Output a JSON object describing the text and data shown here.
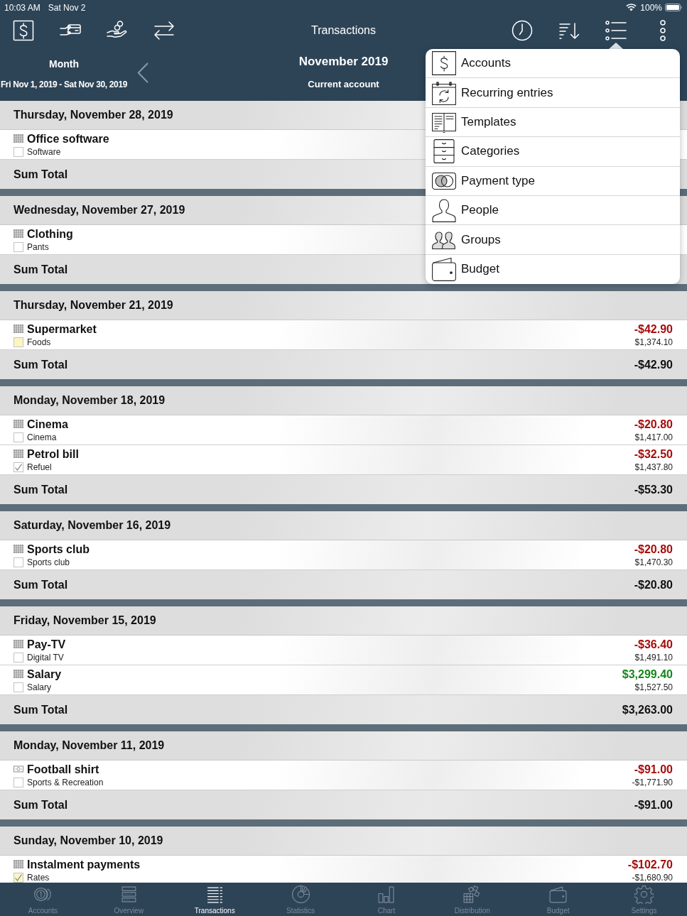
{
  "status_bar": {
    "time": "10:03 AM",
    "date": "Sat Nov 2",
    "battery": "100%"
  },
  "toolbar": {
    "title": "Transactions"
  },
  "period": {
    "mode": "Month",
    "range": "Fri Nov 1, 2019 - Sat Nov 30, 2019",
    "title": "November 2019",
    "account": "Current account"
  },
  "days": [
    {
      "date": "Thursday, November 28, 2019",
      "transactions": [
        {
          "title": "Office software",
          "category": "Software",
          "kind": "grid",
          "checked": false,
          "color": "#ffffff"
        }
      ],
      "sum": {
        "label": "Sum Total"
      }
    },
    {
      "date": "Wednesday, November 27, 2019",
      "transactions": [
        {
          "title": "Clothing",
          "category": "Pants",
          "kind": "grid",
          "checked": false,
          "color": "#ffffff"
        }
      ],
      "sum": {
        "label": "Sum Total"
      }
    },
    {
      "date": "Thursday, November 21, 2019",
      "transactions": [
        {
          "title": "Supermarket",
          "category": "Foods",
          "kind": "grid",
          "checked": false,
          "color": "#fbf5c1",
          "amount": "-$42.90",
          "income": false,
          "balance": "$1,374.10"
        }
      ],
      "sum": {
        "label": "Sum Total",
        "value": "-$42.90"
      }
    },
    {
      "date": "Monday, November 18, 2019",
      "transactions": [
        {
          "title": "Cinema",
          "category": "Cinema",
          "kind": "grid",
          "checked": false,
          "color": "#ffffff",
          "amount": "-$20.80",
          "income": false,
          "balance": "$1,417.00"
        },
        {
          "title": "Petrol bill",
          "category": "Refuel",
          "kind": "grid",
          "checked": true,
          "color": "#ffffff",
          "amount": "-$32.50",
          "income": false,
          "balance": "$1,437.80"
        }
      ],
      "sum": {
        "label": "Sum Total",
        "value": "-$53.30"
      }
    },
    {
      "date": "Saturday, November 16, 2019",
      "transactions": [
        {
          "title": "Sports club",
          "category": "Sports club",
          "kind": "grid",
          "checked": false,
          "color": "#ffffff",
          "amount": "-$20.80",
          "income": false,
          "balance": "$1,470.30"
        }
      ],
      "sum": {
        "label": "Sum Total",
        "value": "-$20.80"
      }
    },
    {
      "date": "Friday, November 15, 2019",
      "transactions": [
        {
          "title": "Pay-TV",
          "category": "Digital TV",
          "kind": "grid",
          "checked": false,
          "color": "#ffffff",
          "amount": "-$36.40",
          "income": false,
          "balance": "$1,491.10"
        },
        {
          "title": "Salary",
          "category": "Salary",
          "kind": "grid",
          "checked": false,
          "color": "#ffffff",
          "amount": "$3,299.40",
          "income": true,
          "balance": "$1,527.50"
        }
      ],
      "sum": {
        "label": "Sum Total",
        "value": "$3,263.00"
      }
    },
    {
      "date": "Monday, November 11, 2019",
      "transactions": [
        {
          "title": "Football shirt",
          "category": "Sports & Recreation",
          "kind": "cash",
          "checked": false,
          "color": "#ffffff",
          "amount": "-$91.00",
          "income": false,
          "balance": "-$1,771.90"
        }
      ],
      "sum": {
        "label": "Sum Total",
        "value": "-$91.00"
      }
    },
    {
      "date": "Sunday, November 10, 2019",
      "transactions": [
        {
          "title": "Instalment payments",
          "category": "Rates",
          "kind": "grid",
          "checked": true,
          "color": "#fbf5c1",
          "amount": "-$102.70",
          "income": false,
          "balance": "-$1,680.90"
        }
      ]
    }
  ],
  "menu": {
    "items": [
      {
        "label": "Accounts",
        "kind": "accounts"
      },
      {
        "label": "Recurring entries",
        "kind": "recurring"
      },
      {
        "label": "Templates",
        "kind": "templates"
      },
      {
        "label": "Categories",
        "kind": "categories"
      },
      {
        "label": "Payment type",
        "kind": "payment"
      },
      {
        "label": "People",
        "kind": "people"
      },
      {
        "label": "Groups",
        "kind": "groups"
      },
      {
        "label": "Budget",
        "kind": "budget"
      }
    ]
  },
  "tabs": [
    {
      "label": "Accounts",
      "kind": "accounts",
      "selected": false
    },
    {
      "label": "Overview",
      "kind": "overview",
      "selected": false
    },
    {
      "label": "Transactions",
      "kind": "transactions",
      "selected": true
    },
    {
      "label": "Statistics",
      "kind": "statistics",
      "selected": false
    },
    {
      "label": "Chart",
      "kind": "chart",
      "selected": false
    },
    {
      "label": "Distribution",
      "kind": "distribution",
      "selected": false
    },
    {
      "label": "Budget",
      "kind": "budget",
      "selected": false
    },
    {
      "label": "Settings",
      "kind": "settings",
      "selected": false
    }
  ]
}
